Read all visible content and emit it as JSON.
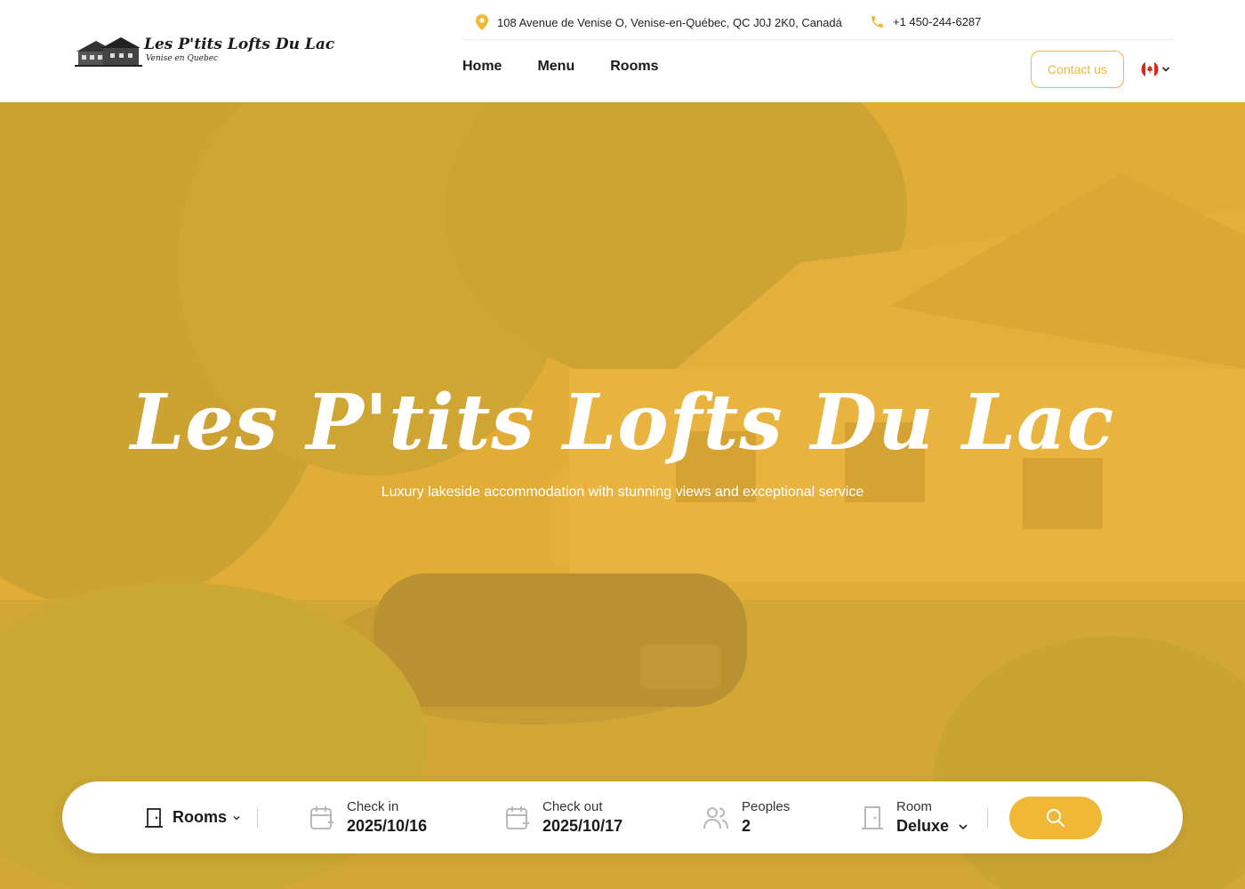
{
  "header": {
    "address": "108 Avenue de Venise O, Venise-en-Québec, QC J0J 2K0, Canadá",
    "phone": "+1 450-244-6287",
    "logo_title": "Les P'tits Lofts Du Lac",
    "logo_subtitle": "Venise en Quebec",
    "nav": [
      {
        "label": "Home"
      },
      {
        "label": "Menu"
      },
      {
        "label": "Rooms"
      }
    ],
    "contact_label": "Contact us",
    "language_flag": "canada-flag-icon"
  },
  "hero": {
    "title": "Les P'tits Lofts Du Lac",
    "subtitle": "Luxury lakeside accommodation with stunning views and exceptional service",
    "overlay_color": "#f0b834"
  },
  "booking": {
    "type_value": "Rooms",
    "checkin_label": "Check in",
    "checkin_value": "2025/10/16",
    "checkout_label": "Check out",
    "checkout_value": "2025/10/17",
    "people_label": "Peoples",
    "people_value": "2",
    "room_label": "Room",
    "room_value": "Deluxe",
    "search_icon": "search-icon"
  },
  "colors": {
    "accent": "#f0b834",
    "text": "#1a1a1a"
  }
}
